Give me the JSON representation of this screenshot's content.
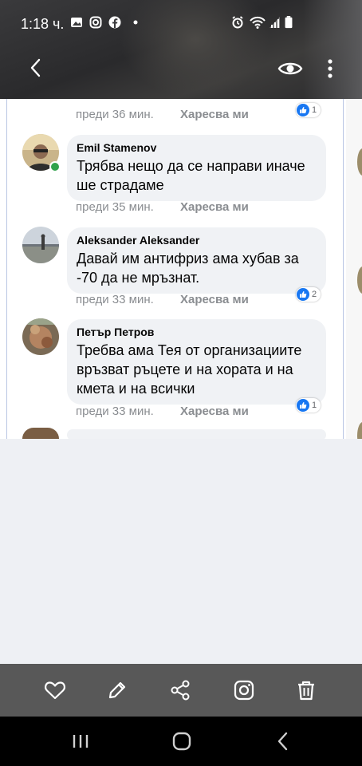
{
  "status_bar": {
    "time": "1:18 ч.",
    "icons": [
      "gallery-icon",
      "instagram-icon",
      "facebook-icon",
      "dot-icon",
      "alarm-icon",
      "wifi-icon",
      "signal-icon",
      "battery-icon"
    ]
  },
  "viewer_header": {
    "icons": [
      "back-icon",
      "eye-icon",
      "more-vertical-icon"
    ]
  },
  "comments": [
    {
      "time": "преди 36 мин.",
      "like_label": "Харесва ми",
      "reactions": "1"
    },
    {
      "author": "Emil Stamenov",
      "text_lines": [
        "Трябва нещо да се направи иначе",
        "ше страдаме"
      ],
      "time": "преди 35 мин.",
      "like_label": "Харесва ми",
      "online": true
    },
    {
      "author": "Aleksander Aleksander",
      "text_lines": [
        "Давай им антифриз ама хубав за",
        "-70 да не мръзнат."
      ],
      "time": "преди 33 мин.",
      "like_label": "Харесва ми",
      "reactions": "2"
    },
    {
      "author": "Петър Петров",
      "text_lines": [
        "Требва ама Тея от организациите",
        "връзват ръцете и на хората и на",
        "кмета и на всички"
      ],
      "time": "преди 33 мин.",
      "like_label": "Харесва ми",
      "reactions": "1"
    }
  ],
  "toolbar": {
    "icons": [
      "heart-icon",
      "edit-icon",
      "share-icon",
      "instagram-icon",
      "trash-icon"
    ]
  },
  "nav_bar": {
    "icons": [
      "recent-apps-icon",
      "home-icon",
      "back-icon"
    ]
  },
  "colors": {
    "like_blue": "#1877f2",
    "online_green": "#31a24c",
    "bubble_bg": "#f0f2f5",
    "toolbar_bg": "#585858"
  }
}
